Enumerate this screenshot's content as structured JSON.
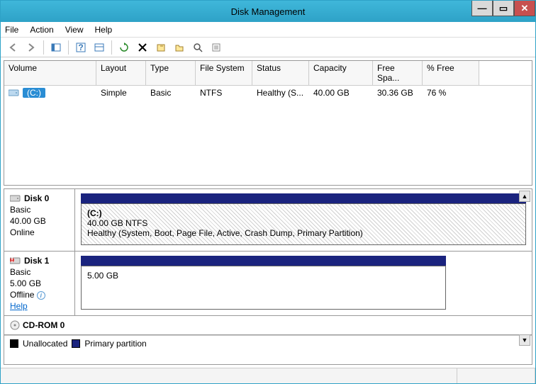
{
  "window": {
    "title": "Disk Management"
  },
  "menu": {
    "file": "File",
    "action": "Action",
    "view": "View",
    "help": "Help"
  },
  "columns": {
    "volume": "Volume",
    "layout": "Layout",
    "type": "Type",
    "fs": "File System",
    "status": "Status",
    "capacity": "Capacity",
    "free": "Free Spa...",
    "pct": "% Free"
  },
  "volumes": [
    {
      "name": "(C:)",
      "layout": "Simple",
      "type": "Basic",
      "fs": "NTFS",
      "status": "Healthy (S...",
      "capacity": "40.00 GB",
      "free": "30.36 GB",
      "pct": "76 %"
    }
  ],
  "disks": [
    {
      "name": "Disk 0",
      "type": "Basic",
      "size": "40.00 GB",
      "state": "Online",
      "icon": "disk-icon",
      "part": {
        "label": "(C:)",
        "line2": "40.00 GB NTFS",
        "line3": "Healthy (System, Boot, Page File, Active, Crash Dump, Primary Partition)",
        "hatched": true,
        "width": "100%"
      }
    },
    {
      "name": "Disk 1",
      "type": "Basic",
      "size": "5.00 GB",
      "state": "Offline",
      "icon": "disk-error-icon",
      "info": true,
      "help": "Help",
      "part": {
        "label": "",
        "line2": "5.00 GB",
        "line3": "",
        "hatched": false,
        "width": "82%"
      }
    },
    {
      "name": "CD-ROM 0",
      "icon": "cdrom-icon"
    }
  ],
  "legend": {
    "unallocated": "Unallocated",
    "primary": "Primary partition"
  }
}
